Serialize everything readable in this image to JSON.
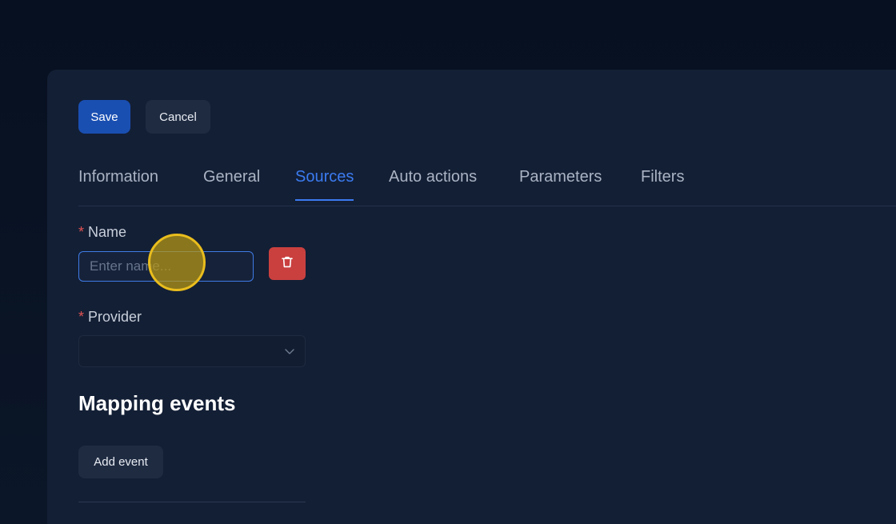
{
  "toolbar": {
    "save_label": "Save",
    "cancel_label": "Cancel"
  },
  "tabs": [
    {
      "label": "Information",
      "active": false
    },
    {
      "label": "General",
      "active": false
    },
    {
      "label": "Sources",
      "active": true
    },
    {
      "label": "Auto actions",
      "active": false
    },
    {
      "label": "Parameters",
      "active": false
    },
    {
      "label": "Filters",
      "active": false
    }
  ],
  "form": {
    "required_marker": "*",
    "name_label": "Name",
    "name_placeholder": "Enter name...",
    "name_value": "",
    "provider_label": "Provider",
    "provider_value": ""
  },
  "mapping": {
    "title": "Mapping events",
    "add_event_label": "Add event"
  },
  "icons": {
    "delete": "trash-icon",
    "provider_dropdown": "chevron-down-icon"
  },
  "colors": {
    "accent": "#3b7bf0",
    "save_button": "#1a4fb2",
    "danger": "#c9403f",
    "required": "#e05252",
    "cursor_highlight": "#e9bd1d"
  }
}
